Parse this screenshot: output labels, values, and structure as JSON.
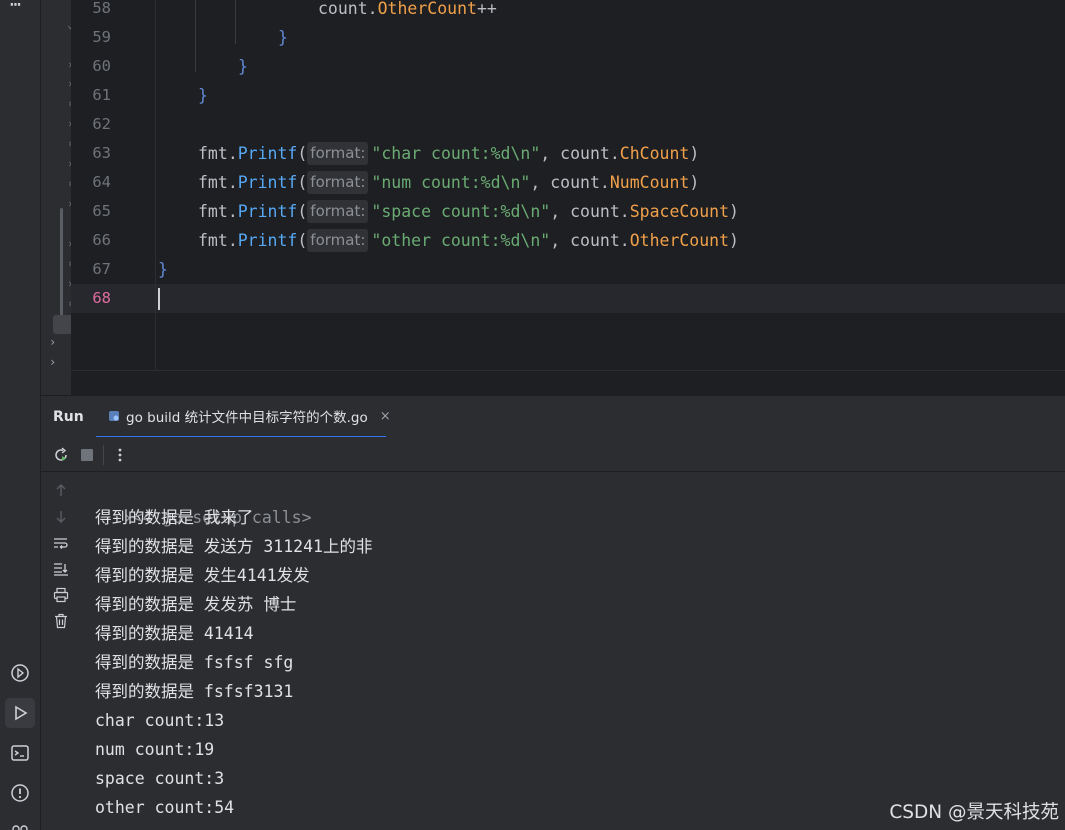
{
  "editor": {
    "lines": [
      {
        "num": "58",
        "parts": [
          {
            "t": "count.",
            "c": "white"
          },
          {
            "t": "OtherCount",
            "c": "field"
          },
          {
            "t": "++",
            "c": "white"
          }
        ]
      },
      {
        "num": "59",
        "parts": [
          {
            "t": "}",
            "c": "brace"
          }
        ]
      },
      {
        "num": "60",
        "parts": [
          {
            "t": "}",
            "c": "brace"
          }
        ]
      },
      {
        "num": "61",
        "parts": [
          {
            "t": "}",
            "c": "brace"
          }
        ]
      },
      {
        "num": "62",
        "parts": []
      },
      {
        "num": "63",
        "parts": [
          {
            "t": "fmt",
            "c": "white"
          },
          {
            "t": ".",
            "c": "white"
          },
          {
            "t": "Printf",
            "c": "kw-fn"
          },
          {
            "t": "(",
            "c": "white"
          },
          {
            "hint": "format:"
          },
          {
            "t": "\"char count:%d\\n\"",
            "c": "str"
          },
          {
            "t": ", count.",
            "c": "white"
          },
          {
            "t": "ChCount",
            "c": "field"
          },
          {
            "t": ")",
            "c": "white"
          }
        ]
      },
      {
        "num": "64",
        "parts": [
          {
            "t": "fmt",
            "c": "white"
          },
          {
            "t": ".",
            "c": "white"
          },
          {
            "t": "Printf",
            "c": "kw-fn"
          },
          {
            "t": "(",
            "c": "white"
          },
          {
            "hint": "format:"
          },
          {
            "t": "\"num count:%d\\n\"",
            "c": "str"
          },
          {
            "t": ", count.",
            "c": "white"
          },
          {
            "t": "NumCount",
            "c": "field"
          },
          {
            "t": ")",
            "c": "white"
          }
        ]
      },
      {
        "num": "65",
        "parts": [
          {
            "t": "fmt",
            "c": "white"
          },
          {
            "t": ".",
            "c": "white"
          },
          {
            "t": "Printf",
            "c": "kw-fn"
          },
          {
            "t": "(",
            "c": "white"
          },
          {
            "hint": "format:"
          },
          {
            "t": "\"space count:%d\\n\"",
            "c": "str"
          },
          {
            "t": ", count.",
            "c": "white"
          },
          {
            "t": "SpaceCount",
            "c": "field"
          },
          {
            "t": ")",
            "c": "white"
          }
        ]
      },
      {
        "num": "66",
        "parts": [
          {
            "t": "fmt",
            "c": "white"
          },
          {
            "t": ".",
            "c": "white"
          },
          {
            "t": "Printf",
            "c": "kw-fn"
          },
          {
            "t": "(",
            "c": "white"
          },
          {
            "hint": "format:"
          },
          {
            "t": "\"other count:%d\\n\"",
            "c": "str"
          },
          {
            "t": ", count.",
            "c": "white"
          },
          {
            "t": "OtherCount",
            "c": "field"
          },
          {
            "t": ")",
            "c": "white"
          }
        ]
      },
      {
        "num": "67",
        "parts": [
          {
            "t": "}",
            "c": "brace"
          }
        ]
      },
      {
        "num": "68",
        "parts": [],
        "current": true
      }
    ]
  },
  "run": {
    "title": "Run",
    "tab_label": "go build 统计文件中目标字符的个数.go",
    "tab_close": "×"
  },
  "console": {
    "setup": "<4 go setup calls>",
    "lines": [
      "得到的数据是 我来了",
      "得到的数据是 发送方 311241上的非",
      "得到的数据是 发生4141发发",
      "得到的数据是 发发苏 博士",
      "得到的数据是 41414",
      "得到的数据是 fsfsf sfg",
      "得到的数据是 fsfsf3131",
      "char count:13",
      "num count:19",
      "space count:3",
      "other count:54"
    ]
  },
  "watermark": "CSDN @景天科技苑",
  "activity": {
    "more": "⋯"
  }
}
